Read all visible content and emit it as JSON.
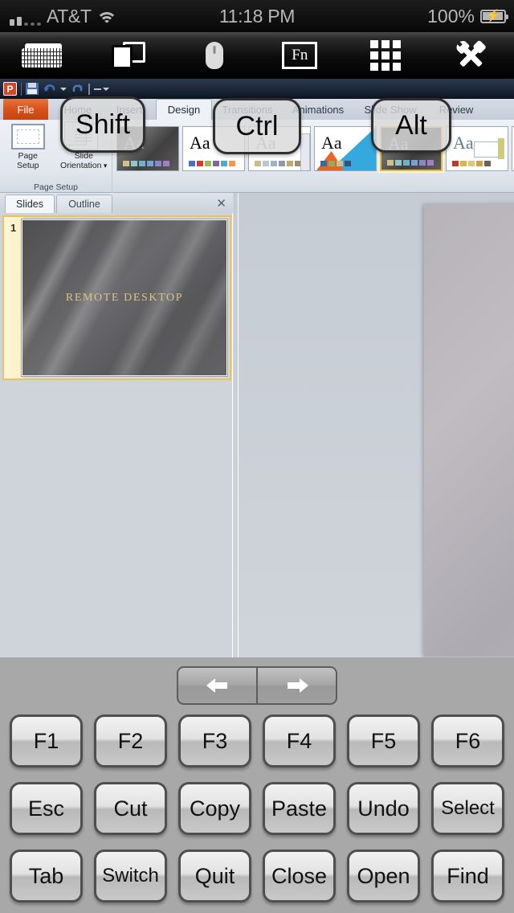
{
  "status_bar": {
    "carrier": "AT&T",
    "time": "11:18 PM",
    "battery": "100%",
    "signal_icon": "signal-bars-icon",
    "wifi_icon": "wifi-icon",
    "battery_icon": "battery-charging-icon"
  },
  "app_toolbar": {
    "buttons": [
      {
        "name": "keyboard-icon",
        "label": "Keyboard"
      },
      {
        "name": "screens-icon",
        "label": "Screens"
      },
      {
        "name": "mouse-icon",
        "label": "Mouse"
      },
      {
        "name": "fn-icon",
        "label": "Fn"
      },
      {
        "name": "numpad-grid-icon",
        "label": "Numpad"
      },
      {
        "name": "tools-icon",
        "label": "Tools"
      }
    ],
    "fn_label": "Fn"
  },
  "remote_screen": {
    "quick_access": {
      "logo": "P",
      "save_label": "Save",
      "undo_label": "Undo",
      "redo_label": "Redo"
    },
    "ribbon": {
      "file_tab": "File",
      "tabs": [
        {
          "label": "Home",
          "active": false
        },
        {
          "label": "Insert",
          "active": false
        },
        {
          "label": "Design",
          "active": true
        },
        {
          "label": "Transitions",
          "active": false
        },
        {
          "label": "Animations",
          "active": false
        },
        {
          "label": "Slide Show",
          "active": false
        },
        {
          "label": "Review",
          "active": false
        }
      ],
      "page_setup_group": {
        "group_label": "Page Setup",
        "page_setup_label": "Page\nSetup",
        "page_setup_line1": "Page",
        "page_setup_line2": "Setup",
        "slide_orientation_line1": "Slide",
        "slide_orientation_line2": "Orientation"
      },
      "themes": {
        "preview_text": "Aa",
        "selected_index": 3
      }
    },
    "slide_panel": {
      "tabs": [
        {
          "label": "Slides",
          "active": true
        },
        {
          "label": "Outline",
          "active": false
        }
      ],
      "close_label": "✕",
      "slides": [
        {
          "number": "1",
          "title": "REMOTE DESKTOP"
        }
      ]
    }
  },
  "modifier_keys": [
    {
      "label": "Shift",
      "name": "shift-key"
    },
    {
      "label": "Ctrl",
      "name": "ctrl-key"
    },
    {
      "label": "Alt",
      "name": "alt-key"
    }
  ],
  "keypad": {
    "nav": {
      "prev": "◀",
      "next": "▶"
    },
    "rows": [
      [
        "F1",
        "F2",
        "F3",
        "F4",
        "F5",
        "F6"
      ],
      [
        "Esc",
        "Cut",
        "Copy",
        "Paste",
        "Undo",
        "Select"
      ],
      [
        "Tab",
        "Switch",
        "Quit",
        "Close",
        "Open",
        "Find"
      ]
    ]
  },
  "colors": {
    "accent_orange": "#d9511d",
    "selection_gold": "#e8c55c",
    "keypad_bg": "#a8a8a8",
    "slide_gold_text": "#d8c38a"
  }
}
